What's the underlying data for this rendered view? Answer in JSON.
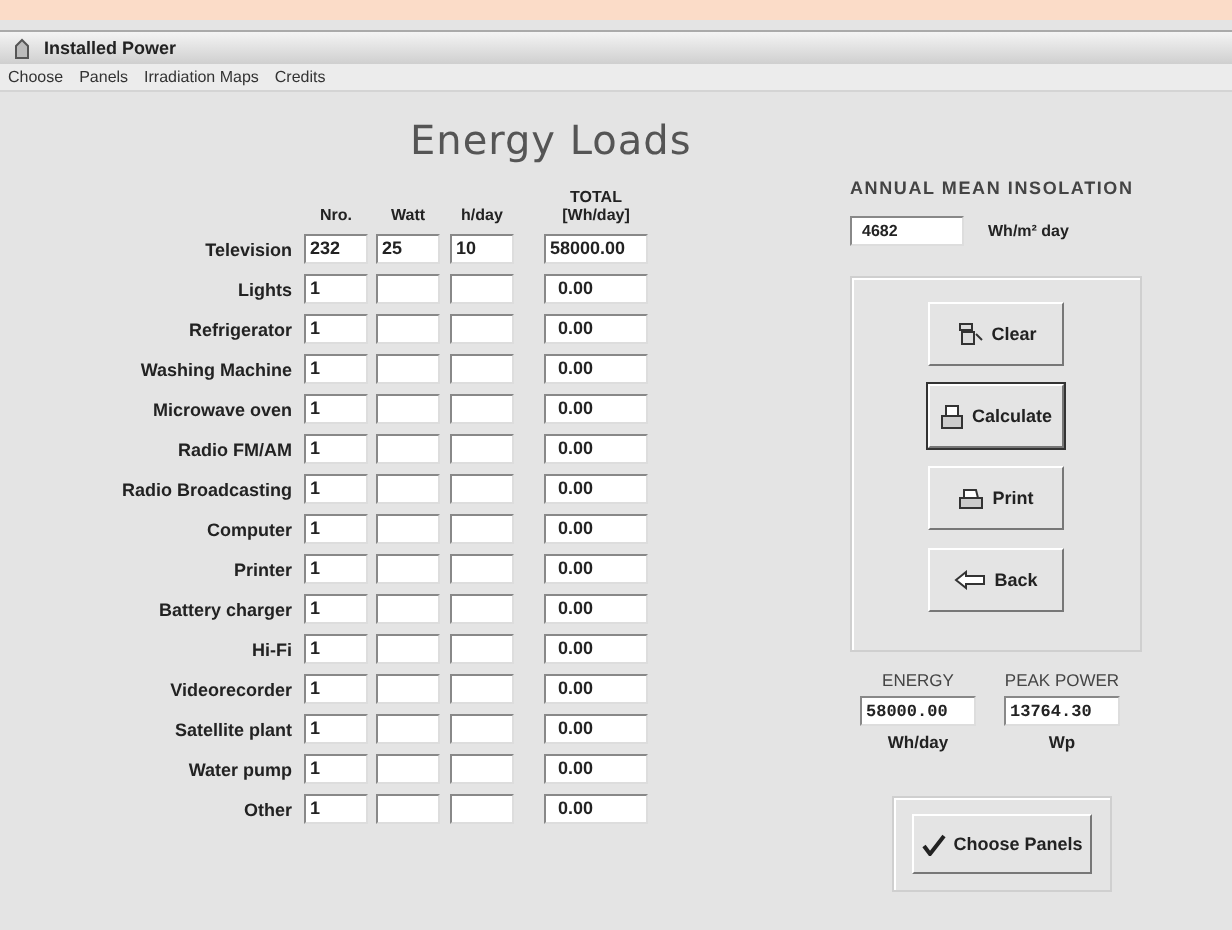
{
  "window": {
    "title": "Installed Power"
  },
  "menu": [
    "Choose",
    "Panels",
    "Irradiation Maps",
    "Credits"
  ],
  "heading": "Energy Loads",
  "columns": [
    "Nro.",
    "Watt",
    "h/day",
    "TOTAL [Wh/day]"
  ],
  "loads": [
    {
      "label": "Television",
      "nro": "232",
      "watt": "25",
      "hday": "10",
      "total": "58000.00"
    },
    {
      "label": "Lights",
      "nro": "1",
      "total": "0.00"
    },
    {
      "label": "Refrigerator",
      "nro": "1",
      "total": "0.00"
    },
    {
      "label": "Washing Machine",
      "nro": "1",
      "total": "0.00"
    },
    {
      "label": "Microwave oven",
      "nro": "1",
      "total": "0.00"
    },
    {
      "label": "Radio FM/AM",
      "nro": "1",
      "total": "0.00"
    },
    {
      "label": "Radio Broadcasting",
      "nro": "1",
      "total": "0.00"
    },
    {
      "label": "Computer",
      "nro": "1",
      "total": "0.00"
    },
    {
      "label": "Printer",
      "nro": "1",
      "total": "0.00"
    },
    {
      "label": "Battery charger",
      "nro": "1",
      "total": "0.00"
    },
    {
      "label": "Hi-Fi",
      "nro": "1",
      "total": "0.00"
    },
    {
      "label": "Videorecorder",
      "nro": "1",
      "total": "0.00"
    },
    {
      "label": "Satellite plant",
      "nro": "1",
      "total": "0.00"
    },
    {
      "label": "Water pump",
      "nro": "1",
      "total": "0.00"
    },
    {
      "label": "Other",
      "nro": "1",
      "total": "0.00"
    }
  ],
  "insolation": {
    "label": "ANNUAL MEAN INSOLATION",
    "value": "4682",
    "unit": "Wh/m² day"
  },
  "actions": [
    {
      "kind": "clear",
      "label": "Clear",
      "default": false
    },
    {
      "kind": "calculate",
      "label": "Calculate",
      "default": true
    },
    {
      "kind": "print",
      "label": "Print",
      "default": false
    },
    {
      "kind": "back",
      "label": "Back",
      "default": false
    }
  ],
  "results": [
    {
      "label": "ENERGY",
      "value": "58000.00",
      "unit": "Wh/day"
    },
    {
      "label": "PEAK POWER",
      "value": "13764.30",
      "unit": "Wp"
    }
  ],
  "choose_button": {
    "label": "Choose Panels"
  }
}
